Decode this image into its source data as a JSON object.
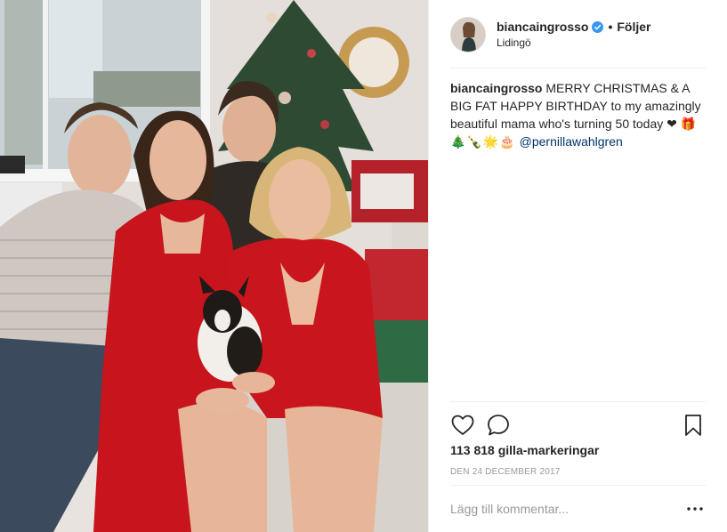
{
  "post": {
    "photo": {
      "alt_icon": "family-photo-image"
    }
  },
  "header": {
    "username": "biancaingrosso",
    "verified_icon": "verified-badge-icon",
    "separator": "•",
    "follow_label": "Följer",
    "location": "Lidingö"
  },
  "caption": {
    "username": "biancaingrosso",
    "text": "MERRY CHRISTMAS & A BIG FAT HAPPY BIRTHDAY to my amazingly beautiful mama who's turning 50 today ❤",
    "emojis": "🎁🎄🍾🌟🎂",
    "mention": "@pernillawahlgren"
  },
  "actions": {
    "like_icon": "heart-icon",
    "comment_icon": "speech-bubble-icon",
    "save_icon": "bookmark-icon"
  },
  "likes": {
    "text": "113 818 gilla-markeringar"
  },
  "date": "DEN 24 DECEMBER 2017",
  "comment": {
    "placeholder": "Lägg till kommentar...",
    "more_icon": "more-options-icon",
    "more_label": "•••"
  },
  "colors": {
    "accent_blue": "#3897f0",
    "mention": "#003569",
    "muted": "#999999",
    "text": "#262626",
    "divider": "#efefef"
  }
}
